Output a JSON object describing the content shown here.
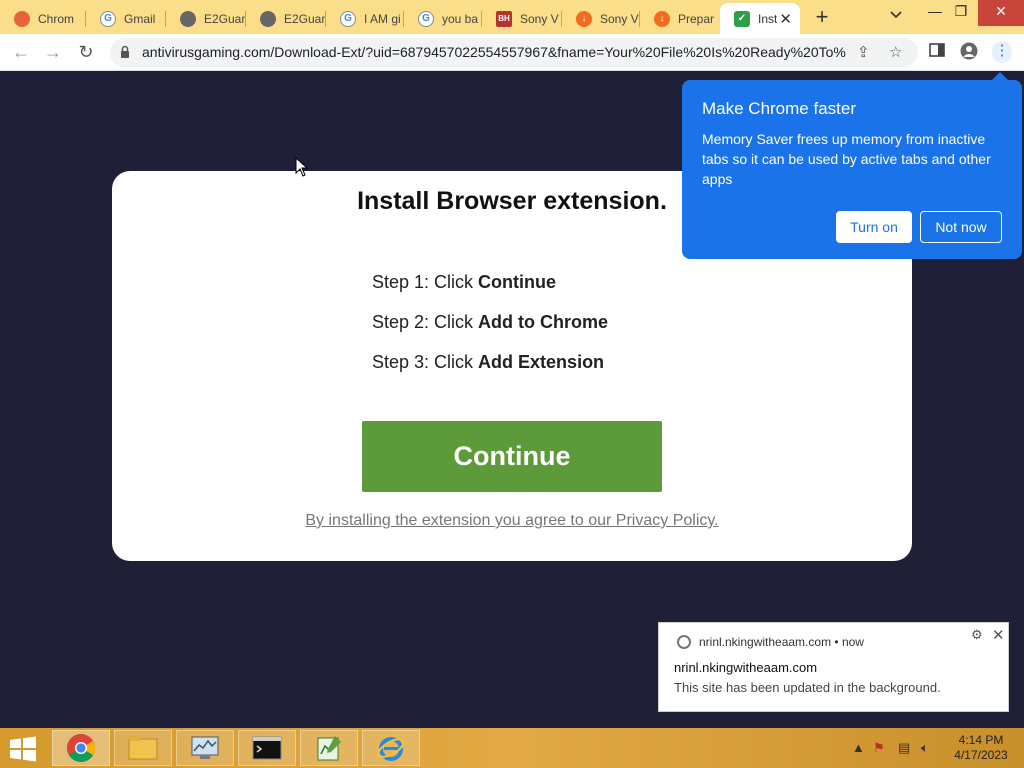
{
  "browser": {
    "tabs": [
      {
        "label": "Chrom",
        "icon": "chrome-icon"
      },
      {
        "label": "Gmail",
        "icon": "google-icon"
      },
      {
        "label": "E2Guar",
        "icon": "globe-icon"
      },
      {
        "label": "E2Guar",
        "icon": "globe-icon"
      },
      {
        "label": "I AM gi",
        "icon": "google-icon"
      },
      {
        "label": "you ba",
        "icon": "google-icon"
      },
      {
        "label": "Sony V",
        "icon": "sony-icon"
      },
      {
        "label": "Sony V",
        "icon": "download-icon"
      },
      {
        "label": "Prepar",
        "icon": "download-icon"
      },
      {
        "label": "Inst",
        "icon": "shield-icon"
      }
    ],
    "new_tab": "+",
    "url": "antivirusgaming.com/Download-Ext/?uid=6879457022554557967&fname=Your%20File%20Is%20Ready%20To%..."
  },
  "page": {
    "title": "Install Browser extension.",
    "steps": [
      {
        "prefix": "Step 1: Click ",
        "action": "Continue"
      },
      {
        "prefix": "Step 2: Click ",
        "action": "Add to Chrome"
      },
      {
        "prefix": "Step 3: Click ",
        "action": "Add Extension"
      }
    ],
    "continue_label": "Continue",
    "privacy_text": "By installing the extension you agree to our Privacy Policy."
  },
  "bubble": {
    "title": "Make Chrome faster",
    "body": "Memory Saver frees up memory from inactive tabs so it can be used by active tabs and other apps",
    "turn_on": "Turn on",
    "not_now": "Not now"
  },
  "notification": {
    "origin": "nrinl.nkingwitheaam.com",
    "time": "now",
    "title": "nrinl.nkingwitheaam.com",
    "message": "This site has been updated in the background."
  },
  "taskbar": {
    "time": "4:14 PM",
    "date": "4/17/2023"
  },
  "colors": {
    "tabstrip": "#fbde89",
    "page_bg": "#1f2038",
    "continue": "#5d9b3a",
    "bubble": "#1a73e8"
  }
}
